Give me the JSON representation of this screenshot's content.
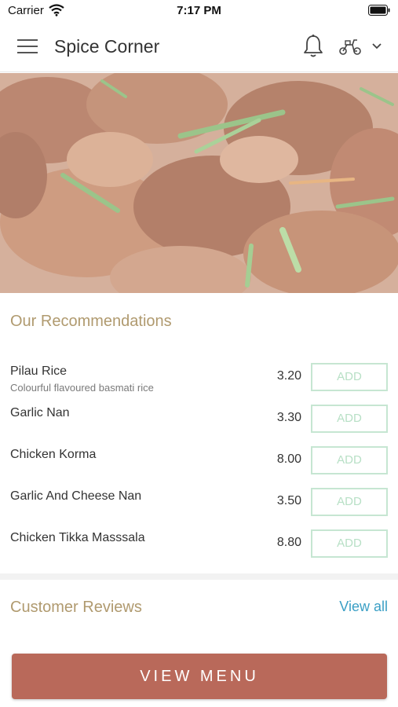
{
  "status_bar": {
    "carrier": "Carrier",
    "time": "7:17 PM"
  },
  "header": {
    "title": "Spice Corner",
    "icons": [
      "menu-icon",
      "bell-icon",
      "scooter-icon",
      "chevron-down-icon"
    ]
  },
  "hero": {
    "icon": "food-photo"
  },
  "recommendations": {
    "title": "Our Recommendations",
    "add_label": "ADD",
    "items": [
      {
        "name": "Pilau Rice",
        "description": "Colourful flavoured basmati rice",
        "price": "3.20"
      },
      {
        "name": "Garlic Nan",
        "description": "",
        "price": "3.30"
      },
      {
        "name": "Chicken Korma",
        "description": "",
        "price": "8.00"
      },
      {
        "name": "Garlic And Cheese Nan",
        "description": "",
        "price": "3.50"
      },
      {
        "name": "Chicken Tikka Masssala",
        "description": "",
        "price": "8.80"
      }
    ]
  },
  "reviews": {
    "title": "Customer Reviews",
    "view_all": "View all"
  },
  "view_menu_button": "VIEW MENU",
  "colors": {
    "accent_gold": "#b09a6f",
    "add_border": "#c6e6d2",
    "link_blue": "#3a9fc5",
    "button_brown": "#b9695a"
  }
}
